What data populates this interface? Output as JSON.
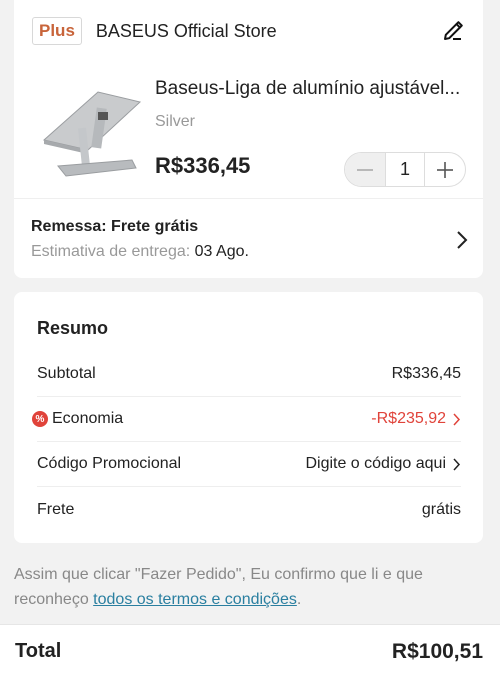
{
  "store": {
    "badge": "Plus",
    "name": "BASEUS Official Store"
  },
  "product": {
    "title": "Baseus-Liga de alumínio ajustável...",
    "variant": "Silver",
    "price": "R$336,45",
    "quantity": "1"
  },
  "shipping": {
    "title": "Remessa: Frete grátis",
    "estimate_label": "Estimativa de entrega:",
    "estimate_date": "03 Ago."
  },
  "summary": {
    "title": "Resumo",
    "rows": [
      {
        "label": "Subtotal",
        "value": "R$336,45"
      },
      {
        "label": "Economia",
        "value": "-R$235,92"
      },
      {
        "label": "Código Promocional",
        "value": "Digite o código aqui"
      },
      {
        "label": "Frete",
        "value": "grátis"
      }
    ]
  },
  "terms": {
    "text": "Assim que clicar \"Fazer Pedido\", Eu confirmo que li e que reconheço ",
    "link": "todos os termos e condições",
    "end": "."
  },
  "total": {
    "label": "Total",
    "value": "R$100,51"
  },
  "colors": {
    "accent_red": "#e0433a",
    "badge_orange": "#c8643a",
    "link": "#2a7fa0"
  }
}
